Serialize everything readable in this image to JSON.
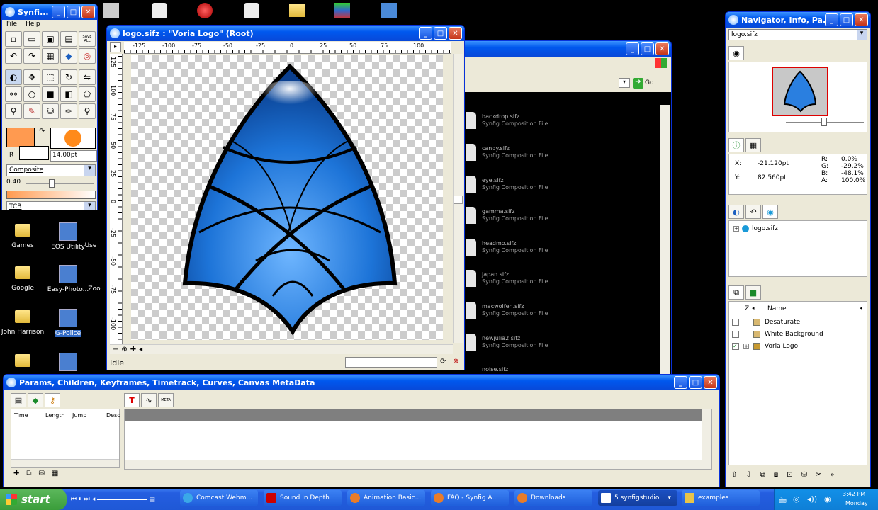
{
  "toolbox": {
    "title": "Synfi...",
    "menu": [
      "File",
      "Help"
    ],
    "save_all": "SAVE ALL",
    "width_value": "14.00pt",
    "blend_method": "Composite",
    "opacity_value": "0.40",
    "interpolation": "TCB",
    "r_label": "R",
    "outline_color": "#ff9a50",
    "fill_color": "#ff8a1a"
  },
  "canvas_window": {
    "title": "logo.sifz : \"Voria Logo\" (Root)",
    "ruler_ticks": [
      "-125",
      "-100",
      "-75",
      "-50",
      "-25",
      "0",
      "25",
      "50",
      "75",
      "100"
    ],
    "ruler_v_ticks": [
      "125",
      "100",
      "75",
      "50",
      "25",
      "0",
      "-25",
      "-50",
      "-75",
      "-100"
    ],
    "status": "Idle"
  },
  "file_browser": {
    "go_label": "Go",
    "files": [
      {
        "name": "backdrop.sifz",
        "type": "Synfig Composition File"
      },
      {
        "name": "candy.sifz",
        "type": "Synfig Composition File"
      },
      {
        "name": "eye.sifz",
        "type": "Synfig Composition File"
      },
      {
        "name": "gamma.sifz",
        "type": "Synfig Composition File"
      },
      {
        "name": "headmo.sifz",
        "type": "Synfig Composition File"
      },
      {
        "name": "japan.sifz",
        "type": "Synfig Composition File"
      },
      {
        "name": "macwolfen.sifz",
        "type": "Synfig Composition File"
      },
      {
        "name": "newjulia2.sifz",
        "type": "Synfig Composition File"
      },
      {
        "name": "noise.sifz",
        "type": "Synfig Composition File"
      }
    ]
  },
  "navigator": {
    "title": "Navigator, Info, Pa...",
    "file_select": "logo.sifz",
    "info": {
      "x_label": "X:",
      "x_value": "-21.120pt",
      "y_label": "Y:",
      "y_value": "82.560pt",
      "r_label": "R:",
      "r_value": "0.0%",
      "g_label": "G:",
      "g_value": "-29.2%",
      "b_label": "B:",
      "b_value": "-48.1%",
      "a_label": "A:",
      "a_value": "100.0%"
    },
    "canvas_tree_item": "logo.sifz",
    "layers_header": {
      "z": "Z",
      "name": "Name"
    },
    "layers": [
      {
        "name": "Desaturate",
        "checked": false
      },
      {
        "name": "White Background",
        "checked": false
      },
      {
        "name": "Voria Logo",
        "checked": true
      }
    ]
  },
  "params_panel": {
    "title": "Params, Children, Keyframes, Timetrack, Curves, Canvas MetaData",
    "keyframe_cols": [
      "Time",
      "Length",
      "Jump",
      "Desc"
    ]
  },
  "desktop_icons": [
    {
      "label": "Games"
    },
    {
      "label": "EOS Utility"
    },
    {
      "label": "Use"
    },
    {
      "label": "Google"
    },
    {
      "label": "Easy-Photo..."
    },
    {
      "label": "Zoo"
    },
    {
      "label": "John Harrison"
    },
    {
      "label": "G-Police"
    }
  ],
  "taskbar": {
    "start": "start",
    "buttons": [
      "Comcast Webm...",
      "Sound In Depth",
      "Animation Basic...",
      "FAQ - Synfig A...",
      "Downloads",
      "5 synfigstudio",
      "examples"
    ],
    "time": "3:42 PM",
    "day": "Monday"
  }
}
